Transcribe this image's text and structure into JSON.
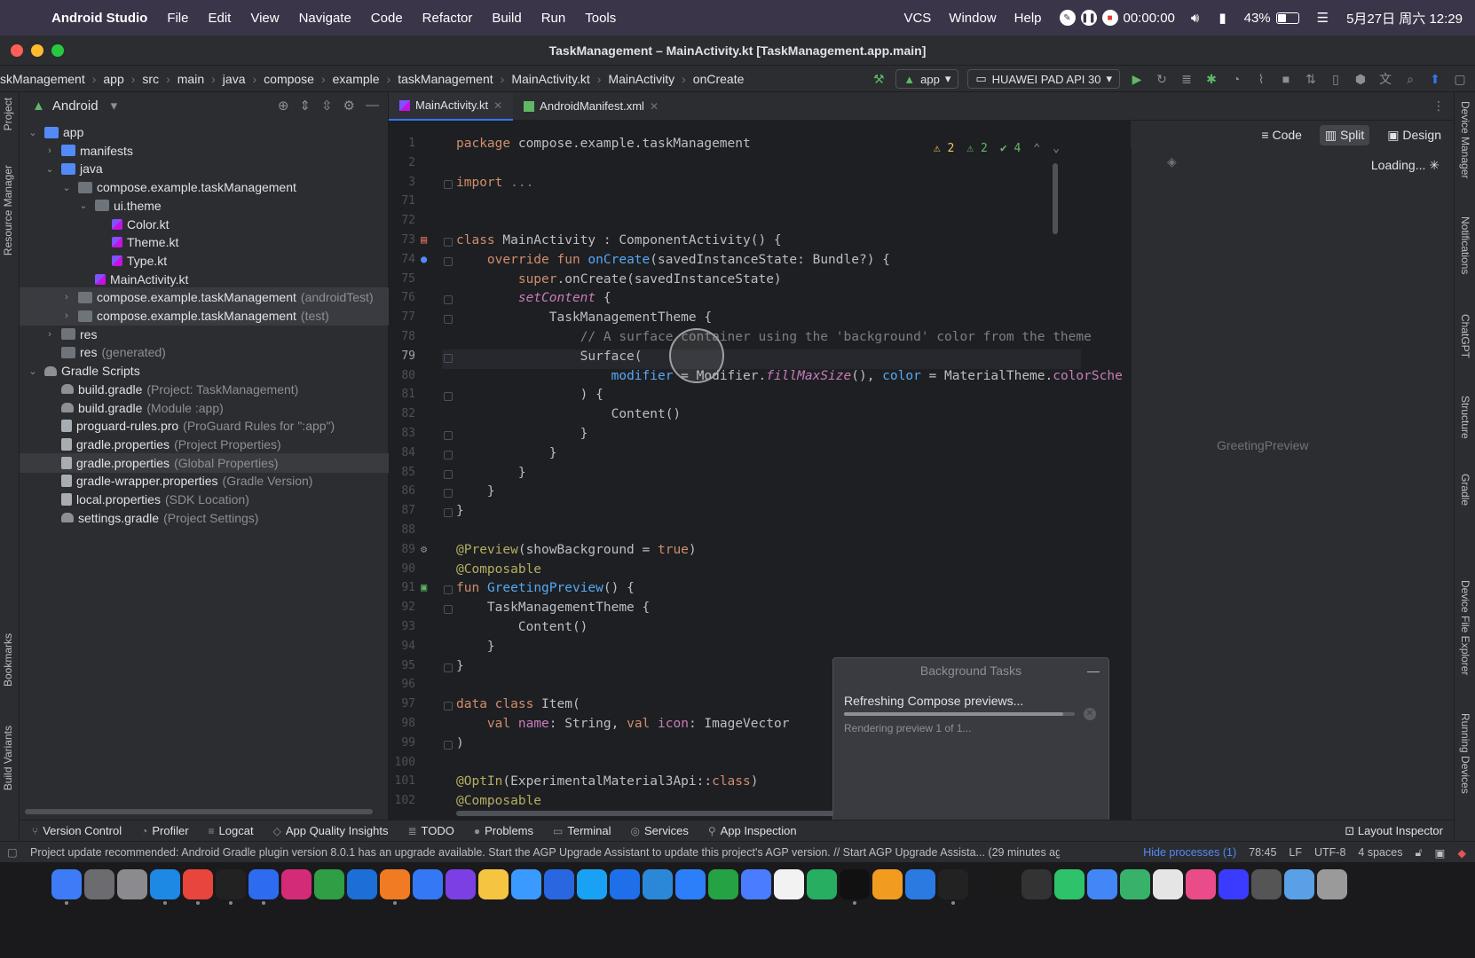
{
  "menubar": {
    "app_name": "Android Studio",
    "items": [
      "File",
      "Edit",
      "View",
      "Navigate",
      "Code",
      "Refactor",
      "Build",
      "Run",
      "Tools"
    ],
    "right_items": [
      "VCS",
      "Window",
      "Help"
    ],
    "timer": "00:00:00",
    "battery_percent": "43%",
    "battery_level": 0.43,
    "datetime": "5月27日 周六 12:29"
  },
  "window": {
    "title": "TaskManagement – MainActivity.kt [TaskManagement.app.main]"
  },
  "breadcrumb": [
    "skManagement",
    "app",
    "src",
    "main",
    "java",
    "compose",
    "example",
    "taskManagement",
    "MainActivity.kt",
    "MainActivity",
    "onCreate"
  ],
  "toolbar": {
    "run_config": "app",
    "device": "HUAWEI PAD API 30"
  },
  "project": {
    "view_label": "Android",
    "tree": [
      {
        "label": "app",
        "dim": "",
        "depth": 0,
        "chev": "⌄",
        "icon": "folder-blue"
      },
      {
        "label": "manifests",
        "dim": "",
        "depth": 1,
        "chev": "›",
        "icon": "folder-blue"
      },
      {
        "label": "java",
        "dim": "",
        "depth": 1,
        "chev": "⌄",
        "icon": "folder-blue"
      },
      {
        "label": "compose.example.taskManagement",
        "dim": "",
        "depth": 2,
        "chev": "⌄",
        "icon": "folder"
      },
      {
        "label": "ui.theme",
        "dim": "",
        "depth": 3,
        "chev": "⌄",
        "icon": "folder"
      },
      {
        "label": "Color.kt",
        "dim": "",
        "depth": 4,
        "chev": "",
        "icon": "kt"
      },
      {
        "label": "Theme.kt",
        "dim": "",
        "depth": 4,
        "chev": "",
        "icon": "kt"
      },
      {
        "label": "Type.kt",
        "dim": "",
        "depth": 4,
        "chev": "",
        "icon": "kt"
      },
      {
        "label": "MainActivity.kt",
        "dim": "",
        "depth": 3,
        "chev": "",
        "icon": "kt"
      },
      {
        "label": "compose.example.taskManagement",
        "dim": "(androidTest)",
        "depth": 2,
        "chev": "›",
        "icon": "folder",
        "sel": true
      },
      {
        "label": "compose.example.taskManagement",
        "dim": "(test)",
        "depth": 2,
        "chev": "›",
        "icon": "folder",
        "sel": true
      },
      {
        "label": "res",
        "dim": "",
        "depth": 1,
        "chev": "›",
        "icon": "folder"
      },
      {
        "label": "res",
        "dim": "(generated)",
        "depth": 1,
        "chev": "",
        "icon": "folder"
      },
      {
        "label": "Gradle Scripts",
        "dim": "",
        "depth": 0,
        "chev": "⌄",
        "icon": "gradle"
      },
      {
        "label": "build.gradle",
        "dim": "(Project: TaskManagement)",
        "depth": 1,
        "chev": "",
        "icon": "gradle"
      },
      {
        "label": "build.gradle",
        "dim": "(Module :app)",
        "depth": 1,
        "chev": "",
        "icon": "gradle"
      },
      {
        "label": "proguard-rules.pro",
        "dim": "(ProGuard Rules for \":app\")",
        "depth": 1,
        "chev": "",
        "icon": "prop"
      },
      {
        "label": "gradle.properties",
        "dim": "(Project Properties)",
        "depth": 1,
        "chev": "",
        "icon": "prop"
      },
      {
        "label": "gradle.properties",
        "dim": "(Global Properties)",
        "depth": 1,
        "chev": "",
        "icon": "prop",
        "sel": true
      },
      {
        "label": "gradle-wrapper.properties",
        "dim": "(Gradle Version)",
        "depth": 1,
        "chev": "",
        "icon": "prop"
      },
      {
        "label": "local.properties",
        "dim": "(SDK Location)",
        "depth": 1,
        "chev": "",
        "icon": "prop"
      },
      {
        "label": "settings.gradle",
        "dim": "(Project Settings)",
        "depth": 1,
        "chev": "",
        "icon": "gradle"
      }
    ]
  },
  "left_strip": [
    "Project",
    "Resource Manager",
    "Bookmarks",
    "Build Variants"
  ],
  "right_strip": [
    "Device Manager",
    "Notifications",
    "ChatGPT",
    "Structure",
    "Gradle",
    "Device File Explorer",
    "Running Devices"
  ],
  "tabs": [
    {
      "label": "MainActivity.kt",
      "active": true
    },
    {
      "label": "AndroidManifest.xml",
      "active": false
    }
  ],
  "editor": {
    "inspections": {
      "warnings": "2",
      "weak": "2",
      "ok": "4"
    },
    "current_line": "79",
    "lines": [
      {
        "n": "1",
        "html": "<span class='kw'>package</span> compose.example.taskManagement"
      },
      {
        "n": "2",
        "html": ""
      },
      {
        "n": "3",
        "html": "<span class='kw'>import</span> <span class='cm'>...</span>"
      },
      {
        "n": "71",
        "html": ""
      },
      {
        "n": "72",
        "html": ""
      },
      {
        "n": "73",
        "html": "<span class='kw'>class</span> MainActivity : ComponentActivity() {"
      },
      {
        "n": "74",
        "html": "    <span class='kw'>override fun</span> <span class='fn'>onCreate</span>(savedInstanceState: Bundle?) {"
      },
      {
        "n": "75",
        "html": "        <span class='kw'>super</span>.onCreate(savedInstanceState)"
      },
      {
        "n": "76",
        "html": "        <span class='it'>setContent</span> {"
      },
      {
        "n": "77",
        "html": "            TaskManagementTheme {"
      },
      {
        "n": "78",
        "html": "                <span class='cm'>// A surface container using the 'background' color from the theme</span>"
      },
      {
        "n": "79",
        "html": "                Surface("
      },
      {
        "n": "80",
        "html": "                    <span class='param'>modifier</span> = Modifier.<span class='it'>fillMaxSize</span>(), <span class='param'>color</span> = MaterialTheme.<span class='pl'>colorSche</span>"
      },
      {
        "n": "81",
        "html": "                ) {"
      },
      {
        "n": "82",
        "html": "                    Content()"
      },
      {
        "n": "83",
        "html": "                }"
      },
      {
        "n": "84",
        "html": "            }"
      },
      {
        "n": "85",
        "html": "        }"
      },
      {
        "n": "86",
        "html": "    }"
      },
      {
        "n": "87",
        "html": "}"
      },
      {
        "n": "88",
        "html": ""
      },
      {
        "n": "89",
        "html": "<span class='ann'>@Preview</span>(showBackground = <span class='kw'>true</span>)"
      },
      {
        "n": "90",
        "html": "<span class='ann'>@Composable</span>"
      },
      {
        "n": "91",
        "html": "<span class='kw'>fun</span> <span class='fn'>GreetingPreview</span>() {"
      },
      {
        "n": "92",
        "html": "    TaskManagementTheme {"
      },
      {
        "n": "93",
        "html": "        Content()"
      },
      {
        "n": "94",
        "html": "    }"
      },
      {
        "n": "95",
        "html": "}"
      },
      {
        "n": "96",
        "html": ""
      },
      {
        "n": "97",
        "html": "<span class='kw'>data class</span> Item("
      },
      {
        "n": "98",
        "html": "    <span class='kw'>val</span> <span class='pl'>name</span>: String, <span class='kw'>val</span> <span class='pl'>icon</span>: ImageVector"
      },
      {
        "n": "99",
        "html": ")"
      },
      {
        "n": "100",
        "html": ""
      },
      {
        "n": "101",
        "html": "<span class='ann'>@OptIn</span>(ExperimentalMaterial3Api::<span class='kw'>class</span>)"
      },
      {
        "n": "102",
        "html": "<span class='ann'>@Composable</span>"
      }
    ]
  },
  "view_modes": {
    "code": "Code",
    "split": "Split",
    "design": "Design"
  },
  "preview": {
    "loading": "Loading...",
    "label": "GreetingPreview"
  },
  "background_tasks": {
    "title": "Background Tasks",
    "task": "Refreshing Compose previews...",
    "progress": 0.95,
    "detail": "Rendering preview 1 of 1..."
  },
  "tool_tabs": [
    "Version Control",
    "Profiler",
    "Logcat",
    "App Quality Insights",
    "TODO",
    "Problems",
    "Terminal",
    "Services",
    "App Inspection"
  ],
  "layout_inspector": "Layout Inspector",
  "status": {
    "message": "Project update recommended: Android Gradle plugin version 8.0.1 has an upgrade available. Start the AGP Upgrade Assistant to update this project's AGP version. // Start AGP Upgrade Assista... (29 minutes ag",
    "hide_processes": "Hide processes (1)",
    "position": "78:45",
    "line_sep": "LF",
    "encoding": "UTF-8",
    "indent": "4 spaces"
  },
  "dock_colors": [
    "#3d7bf7",
    "#6b6b70",
    "#8a8a8f",
    "#1e88e5",
    "#e8453c",
    "#222222",
    "#2d6bf0",
    "#d42b78",
    "#2f9e44",
    "#1c6fd6",
    "#f07b22",
    "#3478f6",
    "#7b3fe4",
    "#f5c542",
    "#3b9aff",
    "#2867e0",
    "#19a1f5",
    "#1f6feb",
    "#2b88d8",
    "#2d7ff9",
    "#25a244",
    "#4a7cff",
    "#f2f2f2",
    "#27ae60",
    "#111111",
    "#f29c1f",
    "#2a7ae2",
    "#222222",
    "#1a1a1a",
    "#333333",
    "#2ec26b",
    "#4287f5",
    "#38b26a",
    "#e5e5e5",
    "#e94c89",
    "#3b3bff",
    "#555555",
    "#5aa0e6",
    "#9a9a9a"
  ]
}
